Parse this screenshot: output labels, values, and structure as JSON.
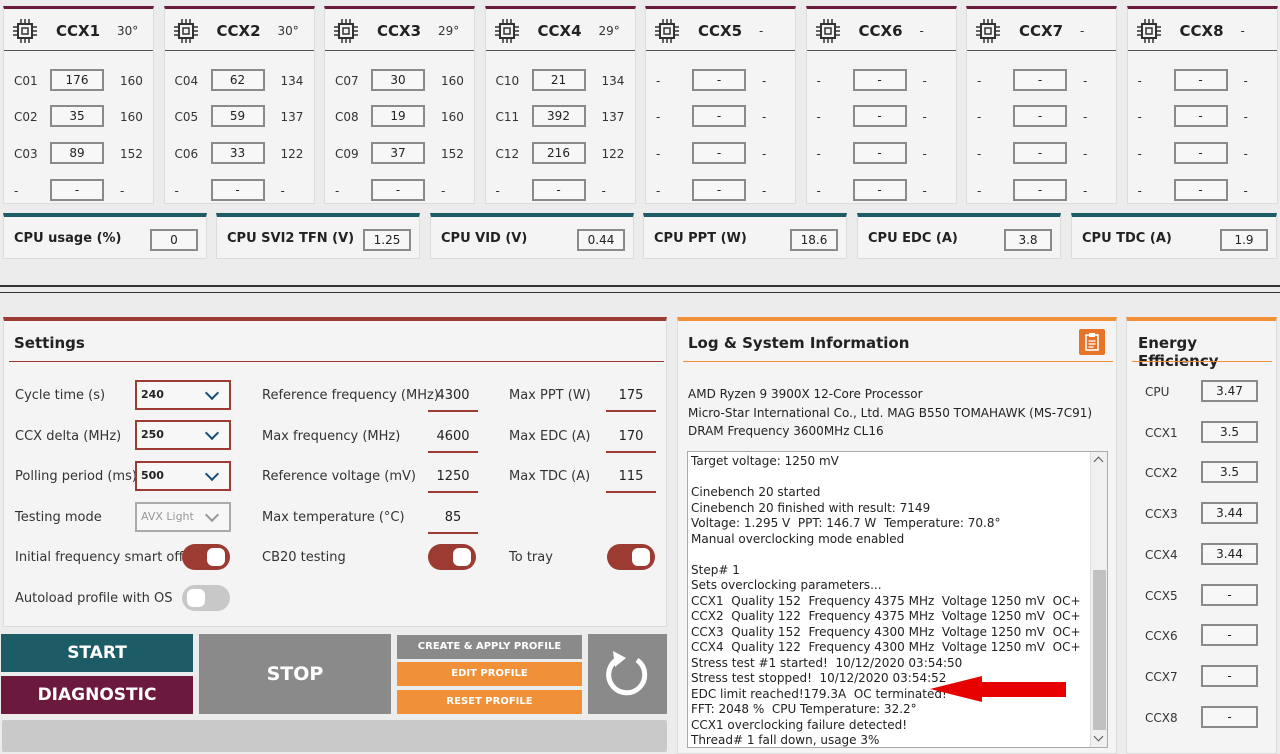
{
  "ccx": [
    {
      "name": "CCX1",
      "temp": "30°",
      "cores": [
        {
          "label": "C01",
          "value": "176",
          "quality": "160"
        },
        {
          "label": "C02",
          "value": "35",
          "quality": "160"
        },
        {
          "label": "C03",
          "value": "89",
          "quality": "152"
        },
        {
          "label": "-",
          "value": "-",
          "quality": "-"
        }
      ]
    },
    {
      "name": "CCX2",
      "temp": "30°",
      "cores": [
        {
          "label": "C04",
          "value": "62",
          "quality": "134"
        },
        {
          "label": "C05",
          "value": "59",
          "quality": "137"
        },
        {
          "label": "C06",
          "value": "33",
          "quality": "122"
        },
        {
          "label": "-",
          "value": "-",
          "quality": "-"
        }
      ]
    },
    {
      "name": "CCX3",
      "temp": "29°",
      "cores": [
        {
          "label": "C07",
          "value": "30",
          "quality": "160"
        },
        {
          "label": "C08",
          "value": "19",
          "quality": "160"
        },
        {
          "label": "C09",
          "value": "37",
          "quality": "152"
        },
        {
          "label": "-",
          "value": "-",
          "quality": "-"
        }
      ]
    },
    {
      "name": "CCX4",
      "temp": "29°",
      "cores": [
        {
          "label": "C10",
          "value": "21",
          "quality": "134"
        },
        {
          "label": "C11",
          "value": "392",
          "quality": "137"
        },
        {
          "label": "C12",
          "value": "216",
          "quality": "122"
        },
        {
          "label": "-",
          "value": "-",
          "quality": "-"
        }
      ]
    },
    {
      "name": "CCX5",
      "temp": "-",
      "cores": [
        {
          "label": "-",
          "value": "-",
          "quality": "-"
        },
        {
          "label": "-",
          "value": "-",
          "quality": "-"
        },
        {
          "label": "-",
          "value": "-",
          "quality": "-"
        },
        {
          "label": "-",
          "value": "-",
          "quality": "-"
        }
      ]
    },
    {
      "name": "CCX6",
      "temp": "-",
      "cores": [
        {
          "label": "-",
          "value": "-",
          "quality": "-"
        },
        {
          "label": "-",
          "value": "-",
          "quality": "-"
        },
        {
          "label": "-",
          "value": "-",
          "quality": "-"
        },
        {
          "label": "-",
          "value": "-",
          "quality": "-"
        }
      ]
    },
    {
      "name": "CCX7",
      "temp": "-",
      "cores": [
        {
          "label": "-",
          "value": "-",
          "quality": "-"
        },
        {
          "label": "-",
          "value": "-",
          "quality": "-"
        },
        {
          "label": "-",
          "value": "-",
          "quality": "-"
        },
        {
          "label": "-",
          "value": "-",
          "quality": "-"
        }
      ]
    },
    {
      "name": "CCX8",
      "temp": "-",
      "cores": [
        {
          "label": "-",
          "value": "-",
          "quality": "-"
        },
        {
          "label": "-",
          "value": "-",
          "quality": "-"
        },
        {
          "label": "-",
          "value": "-",
          "quality": "-"
        },
        {
          "label": "-",
          "value": "-",
          "quality": "-"
        }
      ]
    }
  ],
  "stats": [
    {
      "label": "CPU usage (%)",
      "value": "0"
    },
    {
      "label": "CPU SVI2 TFN (V)",
      "value": "1.25"
    },
    {
      "label": "CPU VID (V)",
      "value": "0.44"
    },
    {
      "label": "CPU PPT (W)",
      "value": "18.6"
    },
    {
      "label": "CPU EDC (A)",
      "value": "3.8"
    },
    {
      "label": "CPU TDC (A)",
      "value": "1.9"
    }
  ],
  "settings": {
    "title": "Settings",
    "cycle_time": {
      "label": "Cycle time (s)",
      "value": "240"
    },
    "ccx_delta": {
      "label": "CCX delta (MHz)",
      "value": "250"
    },
    "polling": {
      "label": "Polling period (ms)",
      "value": "500"
    },
    "testing_mode": {
      "label": "Testing mode",
      "value": "AVX Light"
    },
    "smart_offset": {
      "label": "Initial frequency smart offset",
      "on": true
    },
    "autoload": {
      "label": "Autoload profile with OS",
      "on": false
    },
    "ref_freq": {
      "label": "Reference frequency (MHz)",
      "value": "4300"
    },
    "max_freq": {
      "label": "Max frequency (MHz)",
      "value": "4600"
    },
    "ref_volt": {
      "label": "Reference voltage (mV)",
      "value": "1250"
    },
    "max_temp": {
      "label": "Max temperature (°C)",
      "value": "85"
    },
    "cb20": {
      "label": "CB20 testing",
      "on": true
    },
    "max_ppt": {
      "label": "Max PPT (W)",
      "value": "175"
    },
    "max_edc": {
      "label": "Max EDC (A)",
      "value": "170"
    },
    "max_tdc": {
      "label": "Max TDC (A)",
      "value": "115"
    },
    "to_tray": {
      "label": "To tray",
      "on": true
    }
  },
  "buttons": {
    "start": "START",
    "diagnostic": "DIAGNOSTIC",
    "stop": "STOP",
    "create": "CREATE & APPLY PROFILE",
    "edit": "EDIT PROFILE",
    "reset": "RESET PROFILE"
  },
  "log": {
    "title": "Log & System Information",
    "sysinfo": [
      "AMD Ryzen 9 3900X 12-Core Processor",
      "Micro-Star International Co., Ltd. MAG B550 TOMAHAWK (MS-7C91)",
      "DRAM Frequency 3600MHz CL16"
    ],
    "lines": [
      "Target voltage: 1250 mV",
      "",
      "Cinebench 20 started",
      "Cinebench 20 finished with result: 7149",
      "Voltage: 1.295 V  PPT: 146.7 W  Temperature: 70.8°",
      "Manual overclocking mode enabled",
      "",
      "Step# 1",
      "Sets overclocking parameters...",
      "CCX1  Quality 152  Frequency 4375 MHz  Voltage 1250 mV  OC+",
      "CCX2  Quality 122  Frequency 4375 MHz  Voltage 1250 mV  OC+",
      "CCX3  Quality 152  Frequency 4300 MHz  Voltage 1250 mV  OC+",
      "CCX4  Quality 122  Frequency 4300 MHz  Voltage 1250 mV  OC+",
      "Stress test #1 started!  10/12/2020 03:54:50",
      "Stress test stopped!  10/12/2020 03:54:52",
      "EDC limit reached!179.3A  OC terminated!",
      "FFT: 2048 %  CPU Temperature: 32.2°",
      "CCX1 overclocking failure detected!",
      "Thread# 1 fall down, usage 3%"
    ]
  },
  "energy": {
    "title": "Energy Efficiency",
    "items": [
      {
        "label": "CPU",
        "value": "3.47"
      },
      {
        "label": "CCX1",
        "value": "3.5"
      },
      {
        "label": "CCX2",
        "value": "3.5"
      },
      {
        "label": "CCX3",
        "value": "3.44"
      },
      {
        "label": "CCX4",
        "value": "3.44"
      },
      {
        "label": "CCX5",
        "value": "-"
      },
      {
        "label": "CCX6",
        "value": "-"
      },
      {
        "label": "CCX7",
        "value": "-"
      },
      {
        "label": "CCX8",
        "value": "-"
      }
    ]
  },
  "colors": {
    "maroon": "#6b1a3d",
    "teal": "#1c5c66",
    "rust": "#9b3b32",
    "orange": "#f0913a",
    "gray": "#8a8a8a"
  }
}
